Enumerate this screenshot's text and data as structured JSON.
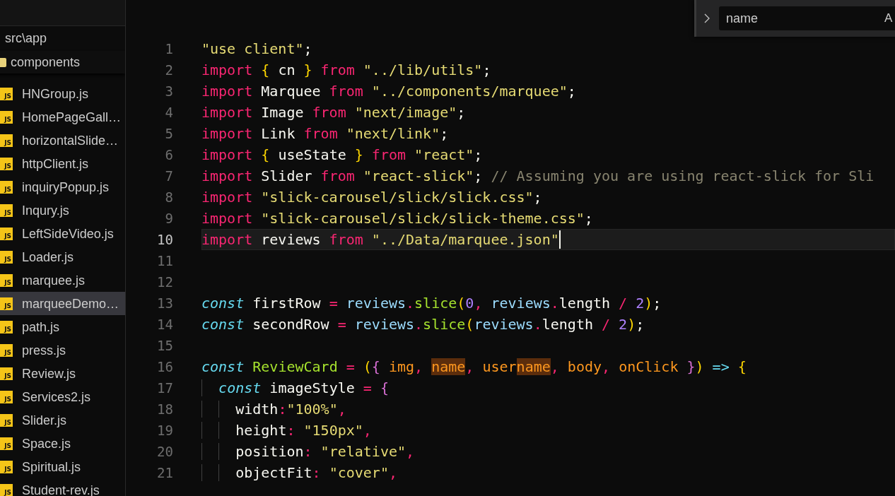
{
  "explorer": {
    "breadcrumb": "src\\app",
    "folder": "components",
    "files": [
      {
        "name": "HNGroup.js",
        "icon": "JS",
        "selected": false
      },
      {
        "name": "HomePageGall…",
        "icon": "JS",
        "selected": false
      },
      {
        "name": "horizontalSlide…",
        "icon": "JS",
        "selected": false
      },
      {
        "name": "httpClient.js",
        "icon": "JS",
        "selected": false
      },
      {
        "name": "inquiryPopup.js",
        "icon": "JS",
        "selected": false
      },
      {
        "name": "Inqury.js",
        "icon": "JS",
        "selected": false
      },
      {
        "name": "LeftSideVideo.js",
        "icon": "JS",
        "selected": false
      },
      {
        "name": "Loader.js",
        "icon": "JS",
        "selected": false
      },
      {
        "name": "marquee.js",
        "icon": "JS",
        "selected": false
      },
      {
        "name": "marqueeDemo…",
        "icon": "JS",
        "selected": true
      },
      {
        "name": "path.js",
        "icon": "JS",
        "selected": false
      },
      {
        "name": "press.js",
        "icon": "JS",
        "selected": false
      },
      {
        "name": "Review.js",
        "icon": "JS",
        "selected": false
      },
      {
        "name": "Services2.js",
        "icon": "JS",
        "selected": false
      },
      {
        "name": "Slider.js",
        "icon": "JS",
        "selected": false
      },
      {
        "name": "Space.js",
        "icon": "JS",
        "selected": false
      },
      {
        "name": "Spiritual.js",
        "icon": "JS",
        "selected": false
      },
      {
        "name": "Student-rev.js",
        "icon": "JS",
        "selected": false
      }
    ]
  },
  "find_widget": {
    "value": "name",
    "match_case": "A"
  },
  "editor": {
    "lines": [
      {
        "number": "1",
        "current": false,
        "tokens": [
          {
            "kind": "str",
            "text": "\"use client\""
          },
          {
            "kind": "plain",
            "text": ";"
          }
        ]
      },
      {
        "number": "2",
        "current": false,
        "tokens": [
          {
            "kind": "kw",
            "text": "import"
          },
          {
            "kind": "br1",
            "text": " {"
          },
          {
            "kind": "plain",
            "text": " cn"
          },
          {
            "kind": "br1",
            "text": " }"
          },
          {
            "kind": "kw",
            "text": " from"
          },
          {
            "kind": "str",
            "text": " \"../lib/utils\""
          },
          {
            "kind": "plain",
            "text": ";"
          }
        ]
      },
      {
        "number": "3",
        "current": false,
        "tokens": [
          {
            "kind": "kw",
            "text": "import"
          },
          {
            "kind": "plain",
            "text": " Marquee"
          },
          {
            "kind": "kw",
            "text": " from"
          },
          {
            "kind": "str",
            "text": " \"../components/marquee\""
          },
          {
            "kind": "plain",
            "text": ";"
          }
        ]
      },
      {
        "number": "4",
        "current": false,
        "tokens": [
          {
            "kind": "kw",
            "text": "import"
          },
          {
            "kind": "plain",
            "text": " Image"
          },
          {
            "kind": "kw",
            "text": " from"
          },
          {
            "kind": "str",
            "text": " \"next/image\""
          },
          {
            "kind": "plain",
            "text": ";"
          }
        ]
      },
      {
        "number": "5",
        "current": false,
        "tokens": [
          {
            "kind": "kw",
            "text": "import"
          },
          {
            "kind": "plain",
            "text": " Link"
          },
          {
            "kind": "kw",
            "text": " from"
          },
          {
            "kind": "str",
            "text": " \"next/link\""
          },
          {
            "kind": "plain",
            "text": ";"
          }
        ]
      },
      {
        "number": "6",
        "current": false,
        "tokens": [
          {
            "kind": "kw",
            "text": "import"
          },
          {
            "kind": "br1",
            "text": " {"
          },
          {
            "kind": "plain",
            "text": " useState"
          },
          {
            "kind": "br1",
            "text": " }"
          },
          {
            "kind": "kw",
            "text": " from"
          },
          {
            "kind": "str",
            "text": " \"react\""
          },
          {
            "kind": "plain",
            "text": ";"
          }
        ]
      },
      {
        "number": "7",
        "current": false,
        "tokens": [
          {
            "kind": "kw",
            "text": "import"
          },
          {
            "kind": "plain",
            "text": " Slider"
          },
          {
            "kind": "kw",
            "text": " from"
          },
          {
            "kind": "str",
            "text": " \"react-slick\""
          },
          {
            "kind": "plain",
            "text": ";"
          },
          {
            "kind": "comment",
            "text": " // Assuming you are using react-slick for Sli"
          }
        ]
      },
      {
        "number": "8",
        "current": false,
        "tokens": [
          {
            "kind": "kw",
            "text": "import"
          },
          {
            "kind": "str",
            "text": " \"slick-carousel/slick/slick.css\""
          },
          {
            "kind": "plain",
            "text": ";"
          }
        ]
      },
      {
        "number": "9",
        "current": false,
        "tokens": [
          {
            "kind": "kw",
            "text": "import"
          },
          {
            "kind": "str",
            "text": " \"slick-carousel/slick/slick-theme.css\""
          },
          {
            "kind": "plain",
            "text": ";"
          }
        ]
      },
      {
        "number": "10",
        "current": true,
        "tokens": [
          {
            "kind": "kw",
            "text": "import"
          },
          {
            "kind": "plain",
            "text": " reviews"
          },
          {
            "kind": "kw",
            "text": " from"
          },
          {
            "kind": "str",
            "text": " \"../Data/marquee.json\""
          }
        ]
      },
      {
        "number": "11",
        "current": false
      },
      {
        "number": "12",
        "current": false
      },
      {
        "number": "13",
        "current": false,
        "tokens": [
          {
            "kind": "storage",
            "text": "const"
          },
          {
            "kind": "plain",
            "text": " firstRow"
          },
          {
            "kind": "op",
            "text": " ="
          },
          {
            "kind": "var",
            "text": " reviews"
          },
          {
            "kind": "op",
            "text": "."
          },
          {
            "kind": "func",
            "text": "slice"
          },
          {
            "kind": "br1",
            "text": "("
          },
          {
            "kind": "num",
            "text": "0"
          },
          {
            "kind": "op",
            "text": ","
          },
          {
            "kind": "var",
            "text": " reviews"
          },
          {
            "kind": "op",
            "text": "."
          },
          {
            "kind": "plain",
            "text": "length"
          },
          {
            "kind": "op",
            "text": " /"
          },
          {
            "kind": "num",
            "text": " 2"
          },
          {
            "kind": "br1",
            "text": ")"
          },
          {
            "kind": "plain",
            "text": ";"
          }
        ]
      },
      {
        "number": "14",
        "current": false,
        "tokens": [
          {
            "kind": "storage",
            "text": "const"
          },
          {
            "kind": "plain",
            "text": " secondRow"
          },
          {
            "kind": "op",
            "text": " ="
          },
          {
            "kind": "var",
            "text": " reviews"
          },
          {
            "kind": "op",
            "text": "."
          },
          {
            "kind": "func",
            "text": "slice"
          },
          {
            "kind": "br1",
            "text": "("
          },
          {
            "kind": "var",
            "text": "reviews"
          },
          {
            "kind": "op",
            "text": "."
          },
          {
            "kind": "plain",
            "text": "length"
          },
          {
            "kind": "op",
            "text": " /"
          },
          {
            "kind": "num",
            "text": " 2"
          },
          {
            "kind": "br1",
            "text": ")"
          },
          {
            "kind": "plain",
            "text": ";"
          }
        ]
      },
      {
        "number": "15",
        "current": false
      },
      {
        "number": "16",
        "current": false,
        "tokens": [
          {
            "kind": "storage",
            "text": "const"
          },
          {
            "kind": "func",
            "text": " ReviewCard"
          },
          {
            "kind": "op",
            "text": " ="
          },
          {
            "kind": "br1",
            "text": " ("
          },
          {
            "kind": "br2",
            "text": "{"
          },
          {
            "kind": "param",
            "text": " img"
          },
          {
            "kind": "op",
            "text": ", "
          },
          {
            "kind": "match",
            "text": "name"
          },
          {
            "kind": "op",
            "text": ","
          },
          {
            "kind": "param",
            "text": " user"
          },
          {
            "kind": "match",
            "text": "name"
          },
          {
            "kind": "op",
            "text": ","
          },
          {
            "kind": "param",
            "text": " body"
          },
          {
            "kind": "op",
            "text": ","
          },
          {
            "kind": "param",
            "text": " onClick"
          },
          {
            "kind": "br2",
            "text": " }"
          },
          {
            "kind": "br1",
            "text": ")"
          },
          {
            "kind": "storage",
            "text": " =>"
          },
          {
            "kind": "br1",
            "text": " {"
          }
        ]
      },
      {
        "number": "17",
        "current": false,
        "tokens": [
          {
            "kind": "storage",
            "text": "  const"
          },
          {
            "kind": "plain",
            "text": " imageStyle"
          },
          {
            "kind": "op",
            "text": " ="
          },
          {
            "kind": "br2",
            "text": " {"
          }
        ]
      },
      {
        "number": "18",
        "current": false,
        "tokens": [
          {
            "kind": "plain",
            "text": "    width"
          },
          {
            "kind": "op",
            "text": ":"
          },
          {
            "kind": "str",
            "text": "\"100%\""
          },
          {
            "kind": "op",
            "text": ","
          }
        ]
      },
      {
        "number": "19",
        "current": false,
        "tokens": [
          {
            "kind": "plain",
            "text": "    height"
          },
          {
            "kind": "op",
            "text": ":"
          },
          {
            "kind": "str",
            "text": " \"150px\""
          },
          {
            "kind": "op",
            "text": ","
          }
        ]
      },
      {
        "number": "20",
        "current": false,
        "tokens": [
          {
            "kind": "plain",
            "text": "    position"
          },
          {
            "kind": "op",
            "text": ":"
          },
          {
            "kind": "str",
            "text": " \"relative\""
          },
          {
            "kind": "op",
            "text": ","
          }
        ]
      },
      {
        "number": "21",
        "current": false,
        "tokens": [
          {
            "kind": "plain",
            "text": "    objectFit"
          },
          {
            "kind": "op",
            "text": ":"
          },
          {
            "kind": "str",
            "text": " \"cover\""
          },
          {
            "kind": "op",
            "text": ","
          }
        ]
      }
    ]
  }
}
